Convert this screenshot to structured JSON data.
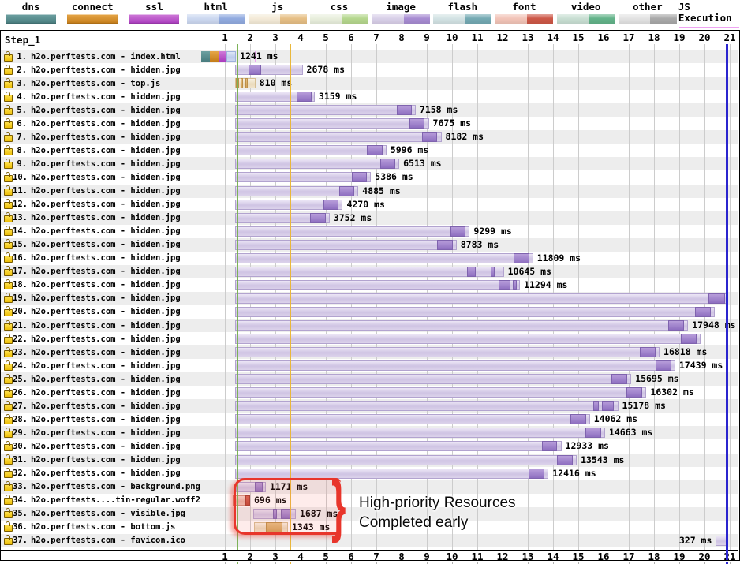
{
  "legend": {
    "items": [
      {
        "id": "dns",
        "label": "dns",
        "style": "solid",
        "color_top": "#6da0a1",
        "color_bottom": "#487c7e"
      },
      {
        "id": "connect",
        "label": "connect",
        "style": "solid",
        "color_top": "#e6a648",
        "color_bottom": "#c47c19"
      },
      {
        "id": "ssl",
        "label": "ssl",
        "style": "solid",
        "color_top": "#cf7ad8",
        "color_bottom": "#a93bbd"
      },
      {
        "id": "html",
        "label": "html",
        "style": "dual",
        "light": "#ccd8f0",
        "dark": "#92abe0"
      },
      {
        "id": "js",
        "label": "js",
        "style": "dual",
        "light": "#f4ebd8",
        "dark": "#e6bf85"
      },
      {
        "id": "css",
        "label": "css",
        "style": "dual",
        "light": "#e9efdd",
        "dark": "#b5d78e"
      },
      {
        "id": "image",
        "label": "image",
        "style": "dual",
        "light": "#d9d0e9",
        "dark": "#a78cd2"
      },
      {
        "id": "flash",
        "label": "flash",
        "style": "dual",
        "light": "#d3e3e4",
        "dark": "#74aab3"
      },
      {
        "id": "font",
        "label": "font",
        "style": "dual",
        "light": "#f2c4b8",
        "dark": "#cd5847"
      },
      {
        "id": "video",
        "label": "video",
        "style": "dual",
        "light": "#c9dfd3",
        "dark": "#63b38a"
      },
      {
        "id": "other",
        "label": "other",
        "style": "dual",
        "light": "#e3e3e3",
        "dark": "#a9a9a9"
      },
      {
        "id": "js-execution",
        "label": "JS Execution",
        "style": "thin",
        "color": "#efa3f2"
      }
    ]
  },
  "panel": {
    "step_label": "Step_1"
  },
  "annotation": {
    "line1": "High-priority Resources",
    "line2": "Completed early"
  },
  "colors": {
    "grid": "#cccccc",
    "stripe": "#ededed",
    "start_render_line": "#7db258",
    "dom_loaded_line": "#e9b73b",
    "doc_complete_line": "#2b25cf",
    "annotation_red": "#e8352b",
    "js_exec_pink": "#efa3f2"
  },
  "chart_data": {
    "type": "bar",
    "variant": "waterfall",
    "title": "",
    "x_unit": "seconds",
    "x_range": [
      0,
      21.3
    ],
    "x_ticks": [
      1,
      2,
      3,
      4,
      5,
      6,
      7,
      8,
      9,
      10,
      11,
      12,
      13,
      14,
      15,
      16,
      17,
      18,
      19,
      20,
      21
    ],
    "grid": true,
    "events": {
      "start_render_s": 1.47,
      "dom_content_loaded_s": 3.55,
      "document_complete_s": 20.85
    },
    "requests": [
      {
        "n": "1",
        "label": "h2o.perftests.com - index.html",
        "resource_type": "html",
        "ms_label": "1241 ms",
        "duration_ms": 1241,
        "start_s": 0.06,
        "end_s": 1.44,
        "segments": [
          [
            "dns",
            0.06,
            0.41
          ],
          [
            "connect",
            0.41,
            0.75
          ],
          [
            "ssl",
            0.75,
            1.06
          ],
          [
            "html",
            1.06,
            1.44
          ]
        ],
        "darks": [],
        "js_exec_s": 2.19
      },
      {
        "n": "2",
        "label": "h2o.perftests.com - hidden.jpg",
        "resource_type": "image",
        "ms_label": "2678 ms",
        "duration_ms": 2678,
        "start_s": 1.4,
        "end_s": 4.08,
        "darks": [
          [
            1.95,
            2.45
          ]
        ]
      },
      {
        "n": "3",
        "label": "h2o.perftests.com - top.js",
        "resource_type": "js",
        "ms_label": "810 ms",
        "duration_ms": 810,
        "start_s": 1.4,
        "end_s": 2.21,
        "darks": [
          [
            1.45,
            1.55
          ],
          [
            1.63,
            1.73
          ],
          [
            1.8,
            1.9
          ]
        ]
      },
      {
        "n": "4",
        "label": "h2o.perftests.com - hidden.jpg",
        "resource_type": "image",
        "ms_label": "3159 ms",
        "duration_ms": 3159,
        "start_s": 1.4,
        "end_s": 4.56,
        "darks": [
          [
            3.85,
            4.45
          ]
        ]
      },
      {
        "n": "5",
        "label": "h2o.perftests.com - hidden.jpg",
        "resource_type": "image",
        "ms_label": "7158 ms",
        "duration_ms": 7158,
        "start_s": 1.4,
        "end_s": 8.56,
        "darks": [
          [
            7.8,
            8.4
          ]
        ]
      },
      {
        "n": "6",
        "label": "h2o.perftests.com - hidden.jpg",
        "resource_type": "image",
        "ms_label": "7675 ms",
        "duration_ms": 7675,
        "start_s": 1.4,
        "end_s": 9.08,
        "darks": [
          [
            8.32,
            8.92
          ]
        ]
      },
      {
        "n": "7",
        "label": "h2o.perftests.com - hidden.jpg",
        "resource_type": "image",
        "ms_label": "8182 ms",
        "duration_ms": 8182,
        "start_s": 1.4,
        "end_s": 9.58,
        "darks": [
          [
            8.82,
            9.42
          ]
        ]
      },
      {
        "n": "8",
        "label": "h2o.perftests.com - hidden.jpg",
        "resource_type": "image",
        "ms_label": "5996 ms",
        "duration_ms": 5996,
        "start_s": 1.4,
        "end_s": 7.4,
        "darks": [
          [
            6.64,
            7.24
          ]
        ]
      },
      {
        "n": "9",
        "label": "h2o.perftests.com - hidden.jpg",
        "resource_type": "image",
        "ms_label": "6513 ms",
        "duration_ms": 6513,
        "start_s": 1.4,
        "end_s": 7.91,
        "darks": [
          [
            7.15,
            7.75
          ]
        ]
      },
      {
        "n": "10",
        "label": "h2o.perftests.com - hidden.jpg",
        "resource_type": "image",
        "ms_label": "5386 ms",
        "duration_ms": 5386,
        "start_s": 1.4,
        "end_s": 6.79,
        "darks": [
          [
            6.03,
            6.63
          ]
        ]
      },
      {
        "n": "11",
        "label": "h2o.perftests.com - hidden.jpg",
        "resource_type": "image",
        "ms_label": "4885 ms",
        "duration_ms": 4885,
        "start_s": 1.4,
        "end_s": 6.29,
        "darks": [
          [
            5.53,
            6.13
          ]
        ]
      },
      {
        "n": "12",
        "label": "h2o.perftests.com - hidden.jpg",
        "resource_type": "image",
        "ms_label": "4270 ms",
        "duration_ms": 4270,
        "start_s": 1.4,
        "end_s": 5.67,
        "darks": [
          [
            4.91,
            5.51
          ]
        ]
      },
      {
        "n": "13",
        "label": "h2o.perftests.com - hidden.jpg",
        "resource_type": "image",
        "ms_label": "3752 ms",
        "duration_ms": 3752,
        "start_s": 1.4,
        "end_s": 5.15,
        "darks": [
          [
            4.39,
            4.99
          ]
        ]
      },
      {
        "n": "14",
        "label": "h2o.perftests.com - hidden.jpg",
        "resource_type": "image",
        "ms_label": "9299 ms",
        "duration_ms": 9299,
        "start_s": 1.4,
        "end_s": 10.7,
        "darks": [
          [
            9.94,
            10.54
          ]
        ]
      },
      {
        "n": "15",
        "label": "h2o.perftests.com - hidden.jpg",
        "resource_type": "image",
        "ms_label": "8783 ms",
        "duration_ms": 8783,
        "start_s": 1.4,
        "end_s": 10.18,
        "darks": [
          [
            9.42,
            10.02
          ]
        ]
      },
      {
        "n": "16",
        "label": "h2o.perftests.com - hidden.jpg",
        "resource_type": "image",
        "ms_label": "11809 ms",
        "duration_ms": 11809,
        "start_s": 1.4,
        "end_s": 13.21,
        "darks": [
          [
            12.45,
            13.05
          ]
        ]
      },
      {
        "n": "17",
        "label": "h2o.perftests.com - hidden.jpg",
        "resource_type": "image",
        "ms_label": "10645 ms",
        "duration_ms": 10645,
        "start_s": 1.4,
        "end_s": 12.05,
        "darks": [
          [
            10.6,
            10.95
          ],
          [
            11.52,
            11.7
          ]
        ]
      },
      {
        "n": "18",
        "label": "h2o.perftests.com - hidden.jpg",
        "resource_type": "image",
        "ms_label": "11294 ms",
        "duration_ms": 11294,
        "start_s": 1.4,
        "end_s": 12.69,
        "darks": [
          [
            11.85,
            12.3
          ],
          [
            12.42,
            12.55
          ]
        ]
      },
      {
        "n": "19",
        "label": "h2o.perftests.com - hidden.jpg",
        "resource_type": "image",
        "ms_label": null,
        "duration_ms": null,
        "start_s": 1.4,
        "end_s": 20.95,
        "darks": [
          [
            20.15,
            20.8
          ]
        ]
      },
      {
        "n": "20",
        "label": "h2o.perftests.com - hidden.jpg",
        "resource_type": "image",
        "ms_label": null,
        "duration_ms": null,
        "start_s": 1.4,
        "end_s": 20.4,
        "darks": [
          [
            19.62,
            20.24
          ]
        ]
      },
      {
        "n": "21",
        "label": "h2o.perftests.com - hidden.jpg",
        "resource_type": "image",
        "ms_label": "17948 ms",
        "duration_ms": 17948,
        "start_s": 1.4,
        "end_s": 19.35,
        "darks": [
          [
            18.57,
            19.19
          ]
        ]
      },
      {
        "n": "22",
        "label": "h2o.perftests.com - hidden.jpg",
        "resource_type": "image",
        "ms_label": null,
        "duration_ms": null,
        "start_s": 1.4,
        "end_s": 19.85,
        "darks": [
          [
            19.07,
            19.69
          ]
        ]
      },
      {
        "n": "23",
        "label": "h2o.perftests.com - hidden.jpg",
        "resource_type": "image",
        "ms_label": "16818 ms",
        "duration_ms": 16818,
        "start_s": 1.4,
        "end_s": 18.22,
        "darks": [
          [
            17.44,
            18.06
          ]
        ]
      },
      {
        "n": "24",
        "label": "h2o.perftests.com - hidden.jpg",
        "resource_type": "image",
        "ms_label": "17439 ms",
        "duration_ms": 17439,
        "start_s": 1.4,
        "end_s": 18.84,
        "darks": [
          [
            18.06,
            18.68
          ]
        ]
      },
      {
        "n": "25",
        "label": "h2o.perftests.com - hidden.jpg",
        "resource_type": "image",
        "ms_label": "15695 ms",
        "duration_ms": 15695,
        "start_s": 1.4,
        "end_s": 17.1,
        "darks": [
          [
            16.32,
            16.94
          ]
        ]
      },
      {
        "n": "26",
        "label": "h2o.perftests.com - hidden.jpg",
        "resource_type": "image",
        "ms_label": "16302 ms",
        "duration_ms": 16302,
        "start_s": 1.4,
        "end_s": 17.7,
        "darks": [
          [
            16.92,
            17.54
          ]
        ]
      },
      {
        "n": "27",
        "label": "h2o.perftests.com - hidden.jpg",
        "resource_type": "image",
        "ms_label": "15178 ms",
        "duration_ms": 15178,
        "start_s": 1.4,
        "end_s": 16.58,
        "darks": [
          [
            15.6,
            15.8
          ],
          [
            15.95,
            16.42
          ]
        ]
      },
      {
        "n": "28",
        "label": "h2o.perftests.com - hidden.jpg",
        "resource_type": "image",
        "ms_label": "14062 ms",
        "duration_ms": 14062,
        "start_s": 1.4,
        "end_s": 15.46,
        "darks": [
          [
            14.68,
            15.3
          ]
        ]
      },
      {
        "n": "29",
        "label": "h2o.perftests.com - hidden.jpg",
        "resource_type": "image",
        "ms_label": "14663 ms",
        "duration_ms": 14663,
        "start_s": 1.4,
        "end_s": 16.06,
        "darks": [
          [
            15.28,
            15.9
          ]
        ]
      },
      {
        "n": "30",
        "label": "h2o.perftests.com - hidden.jpg",
        "resource_type": "image",
        "ms_label": "12933 ms",
        "duration_ms": 12933,
        "start_s": 1.4,
        "end_s": 14.33,
        "darks": [
          [
            13.55,
            14.17
          ]
        ]
      },
      {
        "n": "31",
        "label": "h2o.perftests.com - hidden.jpg",
        "resource_type": "image",
        "ms_label": "13543 ms",
        "duration_ms": 13543,
        "start_s": 1.4,
        "end_s": 14.94,
        "darks": [
          [
            14.16,
            14.78
          ]
        ]
      },
      {
        "n": "32",
        "label": "h2o.perftests.com - hidden.jpg",
        "resource_type": "image",
        "ms_label": "12416 ms",
        "duration_ms": 12416,
        "start_s": 1.4,
        "end_s": 13.82,
        "darks": [
          [
            13.04,
            13.66
          ]
        ]
      },
      {
        "n": "33",
        "label": "h2o.perftests.com - background.png",
        "resource_type": "image",
        "ms_label": "1171 ms",
        "duration_ms": 1171,
        "start_s": 1.45,
        "end_s": 2.62,
        "darks": [
          [
            2.2,
            2.5
          ]
        ]
      },
      {
        "n": "34",
        "label": "h2o.perftests....tin-regular.woff2",
        "resource_type": "font",
        "ms_label": "696 ms",
        "duration_ms": 696,
        "start_s": 1.3,
        "end_s": 2.0,
        "darks": [
          [
            1.8,
            2.0
          ]
        ]
      },
      {
        "n": "35",
        "label": "h2o.perftests.com - visible.jpg",
        "resource_type": "image",
        "ms_label": "1687 ms",
        "duration_ms": 1687,
        "start_s": 2.12,
        "end_s": 3.81,
        "darks": [
          [
            2.9,
            3.06
          ],
          [
            3.22,
            3.64
          ]
        ]
      },
      {
        "n": "36",
        "label": "h2o.perftests.com - bottom.js",
        "resource_type": "js",
        "ms_label": "1343 ms",
        "duration_ms": 1343,
        "start_s": 2.16,
        "end_s": 3.5,
        "darks": [
          [
            2.62,
            3.28
          ]
        ]
      },
      {
        "n": "37",
        "label": "h2o.perftests.com - favicon.ico",
        "resource_type": "image",
        "ms_label": "327 ms",
        "duration_ms": 327,
        "start_s": 20.45,
        "end_s": 20.92,
        "darks": [],
        "label_side": "left"
      }
    ]
  }
}
